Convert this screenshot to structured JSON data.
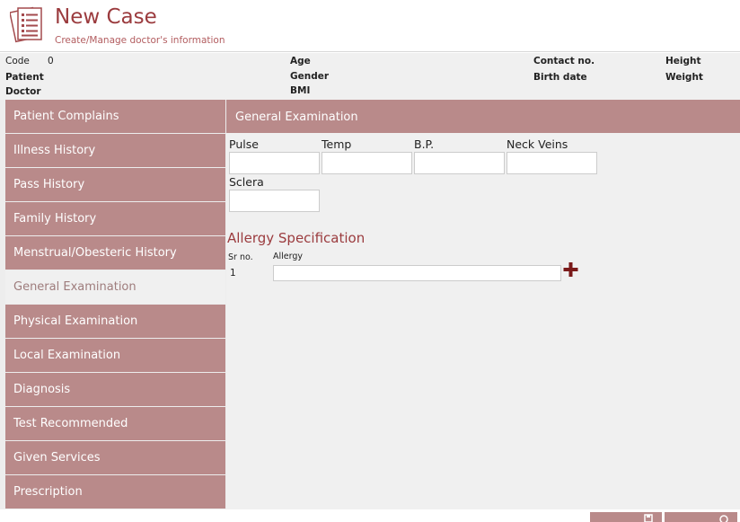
{
  "header": {
    "title": "New Case",
    "subtitle": "Create/Manage doctor's information",
    "icon": "document-list-icon"
  },
  "info": {
    "code_label": "Code",
    "code_value": "0",
    "patient_label": "Patient",
    "doctor_label": "Doctor",
    "age_label": "Age",
    "gender_label": "Gender",
    "bmi_label": "BMI",
    "contact_label": "Contact no.",
    "birthdate_label": "Birth date",
    "height_label": "Height",
    "weight_label": "Weight"
  },
  "sidebar": {
    "items": [
      {
        "label": "Patient Complains",
        "active": false
      },
      {
        "label": "Illness History",
        "active": false
      },
      {
        "label": "Pass History",
        "active": false
      },
      {
        "label": "Family History",
        "active": false
      },
      {
        "label": "Menstrual/Obesteric History",
        "active": false
      },
      {
        "label": "General Examination",
        "active": true
      },
      {
        "label": "Physical Examination",
        "active": false
      },
      {
        "label": "Local Examination",
        "active": false
      },
      {
        "label": "Diagnosis",
        "active": false
      },
      {
        "label": "Test Recommended",
        "active": false
      },
      {
        "label": "Given Services",
        "active": false
      },
      {
        "label": "Prescription",
        "active": false
      }
    ]
  },
  "main": {
    "section_title": "General Examination",
    "fields": {
      "pulse": {
        "label": "Pulse",
        "value": ""
      },
      "temp": {
        "label": "Temp",
        "value": ""
      },
      "bp": {
        "label": "B.P.",
        "value": ""
      },
      "neck_veins": {
        "label": "Neck Veins",
        "value": ""
      },
      "sclera": {
        "label": "Sclera",
        "value": ""
      }
    },
    "allergy": {
      "title": "Allergy Specification",
      "col_srno": "Sr no.",
      "col_allergy": "Allergy",
      "rows": [
        {
          "sr": "1",
          "allergy": ""
        }
      ],
      "add_icon": "plus-icon"
    }
  },
  "colors": {
    "accent": "#b98a8a",
    "brand": "#9b3b3e",
    "plus": "#7a1a1a"
  }
}
